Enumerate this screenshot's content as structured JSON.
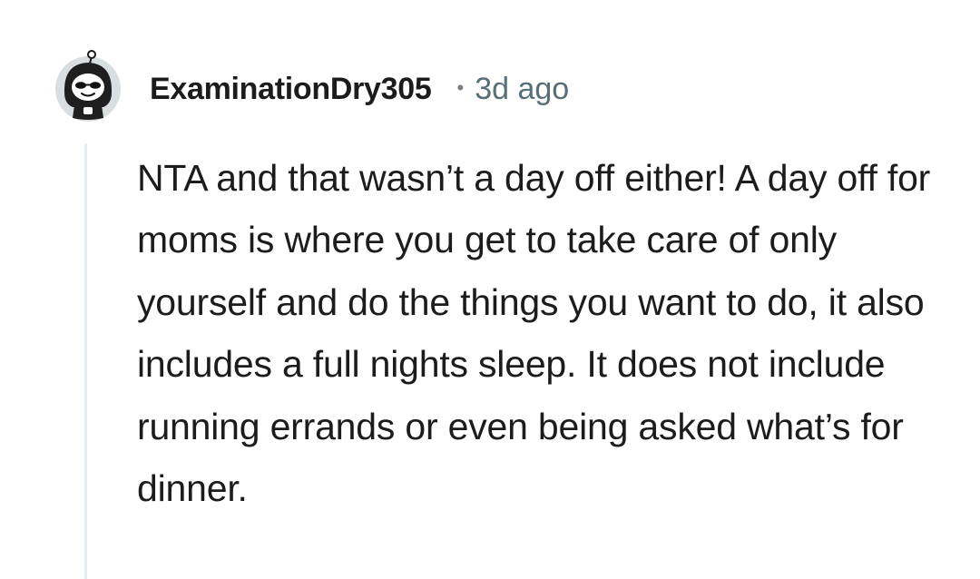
{
  "comment": {
    "author": "ExaminationDry305",
    "separator": "•",
    "timestamp": "3d ago",
    "body": "NTA and that wasn’t a day off either! A day off for moms is where you get to take care of only yourself and do the things you want to do, it also includes a full nights sleep. It does not include running errands or even being asked what’s for dinner."
  },
  "avatar": {
    "icon": "snoo-avatar-sunglasses-icon",
    "background_color": "#d9dee1"
  },
  "colors": {
    "username": "#1c1c1c",
    "timestamp": "#576f76",
    "body_text": "#1c1c1c",
    "thread_line": "#e5ebee",
    "background": "#ffffff"
  }
}
